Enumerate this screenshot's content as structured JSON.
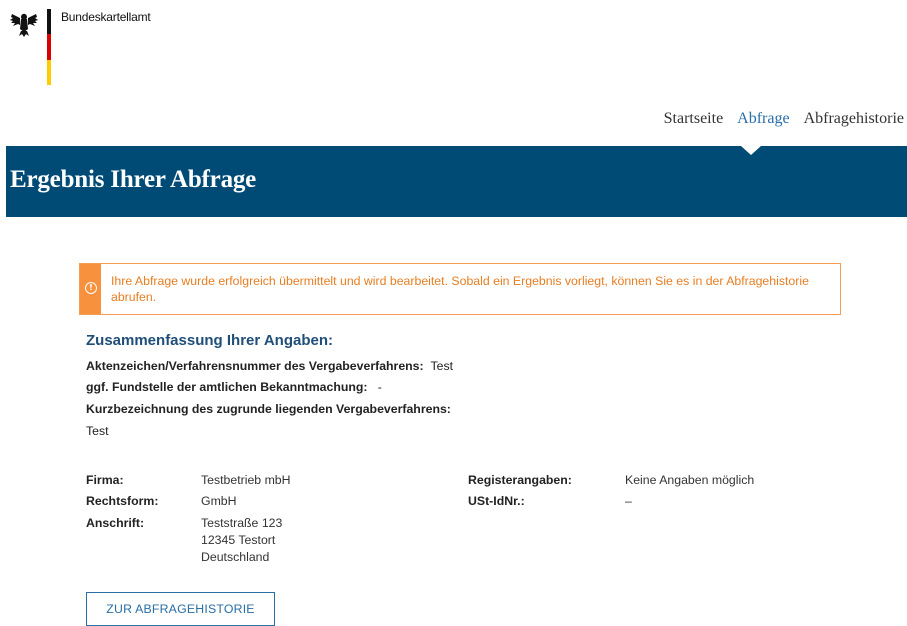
{
  "brand": {
    "name": "Bundeskartellamt"
  },
  "nav": {
    "items": [
      {
        "label": "Startseite",
        "active": false
      },
      {
        "label": "Abfrage",
        "active": true
      },
      {
        "label": "Abfragehistorie",
        "active": false
      }
    ]
  },
  "banner": {
    "title": "Ergebnis Ihrer Abfrage",
    "color": "#004b76"
  },
  "alert": {
    "icon": "info-icon",
    "text": "Ihre Abfrage wurde erfolgreich übermittelt und wird bearbeitet. Sobald ein Ergebnis vorliegt, können Sie es in der Abfragehistorie abrufen.",
    "color": "#f7913d"
  },
  "summary": {
    "title": "Zusammenfassung Ihrer Angaben:",
    "aktenzeichen_label": "Aktenzeichen/Verfahrensnummer des Vergabeverfahrens:",
    "aktenzeichen_value": "Test",
    "fundstelle_label": "ggf. Fundstelle der amtlichen Bekanntmachung:",
    "fundstelle_value": "-",
    "kurz_label": "Kurzbezeichnung des zugrunde liegenden Vergabeverfahrens:",
    "kurz_value": "Test"
  },
  "details": {
    "firma_label": "Firma:",
    "firma_value": "Testbetrieb mbH",
    "rechtsform_label": "Rechtsform:",
    "rechtsform_value": "GmbH",
    "anschrift_label": "Anschrift:",
    "anschrift_line1": "Teststraße 123",
    "anschrift_line2": "12345 Testort",
    "anschrift_line3": "Deutschland",
    "register_label": "Registerangaben:",
    "register_value": "Keine Angaben möglich",
    "ust_label": "USt-IdNr.:",
    "ust_value": "–"
  },
  "button": {
    "label": "ZUR ABFRAGEHISTORIE"
  }
}
